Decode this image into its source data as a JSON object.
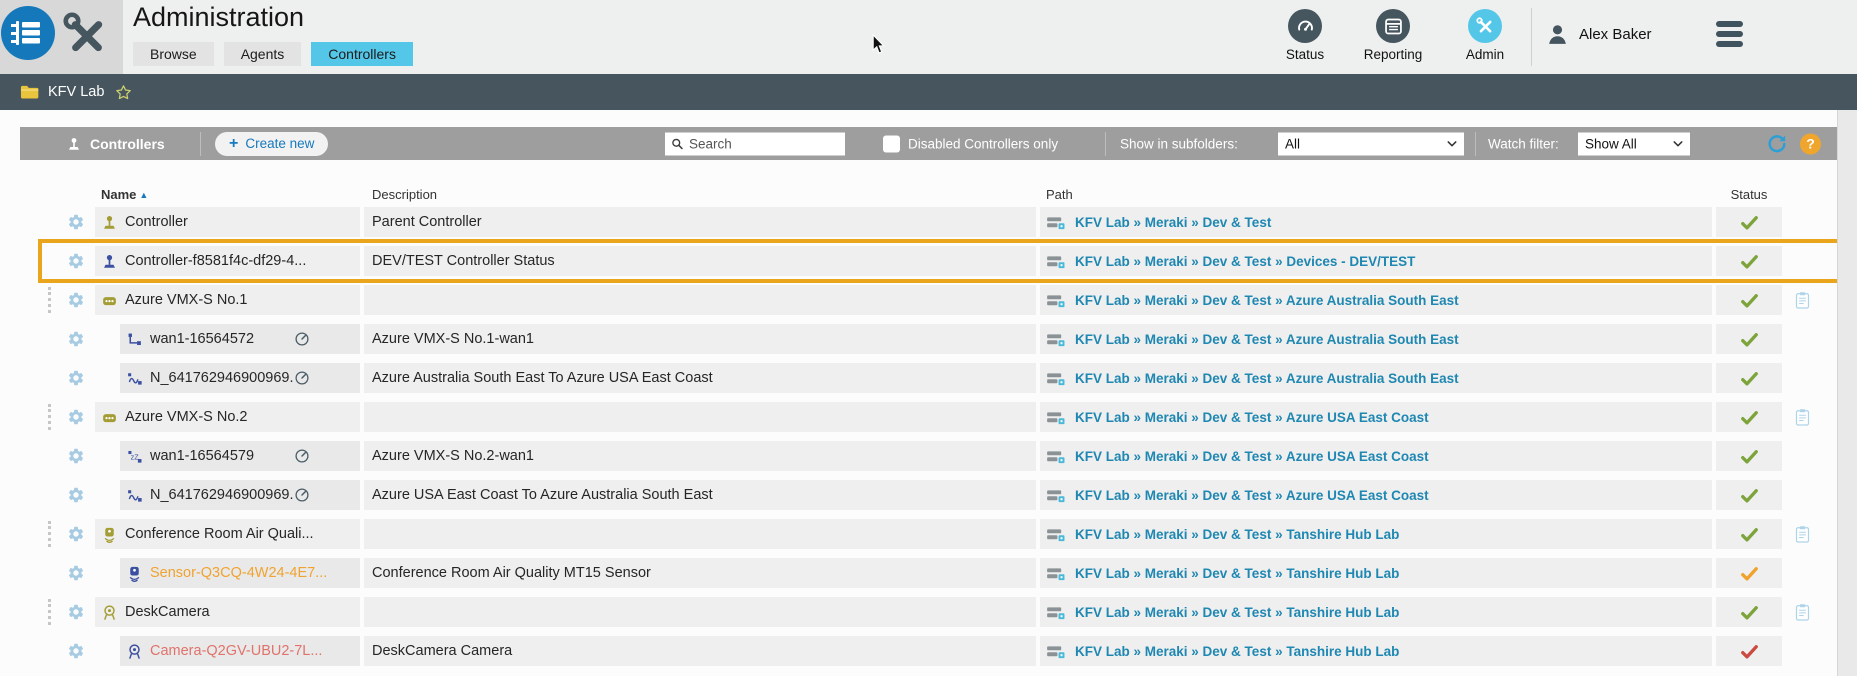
{
  "header": {
    "title": "Administration",
    "tabs": [
      {
        "label": "Browse",
        "active": false
      },
      {
        "label": "Agents",
        "active": false
      },
      {
        "label": "Controllers",
        "active": true
      }
    ],
    "nav": [
      {
        "label": "Status",
        "icon": "gauge-icon"
      },
      {
        "label": "Reporting",
        "icon": "report-icon"
      },
      {
        "label": "Admin",
        "icon": "tools-icon"
      }
    ],
    "user": "Alex Baker"
  },
  "breadcrumb": {
    "location": "KFV Lab"
  },
  "toolbar": {
    "title": "Controllers",
    "create_label": "Create new",
    "search_placeholder": "Search",
    "checkbox_label": "Disabled Controllers only",
    "checkbox_checked": false,
    "subfolders_label": "Show in subfolders:",
    "subfolders_value": "All",
    "watch_label": "Watch filter:",
    "watch_value": "Show All"
  },
  "table": {
    "columns": [
      "Name",
      "Description",
      "Path",
      "Status"
    ],
    "sorted_by": "Name",
    "sort_direction": "asc",
    "rows": [
      {
        "name": "Controller",
        "icon": "joystick",
        "icon_tone": "olive",
        "name_tone": "default",
        "indent": false,
        "gauge": false,
        "drag_handle": false,
        "description": "Parent Controller",
        "path": "KFV Lab » Meraki » Dev & Test",
        "status": "ok",
        "clipboard": false,
        "highlighted": false
      },
      {
        "name": "Controller-f8581f4c-df29-4...",
        "icon": "joystick",
        "icon_tone": "blue",
        "name_tone": "default",
        "indent": false,
        "gauge": false,
        "drag_handle": false,
        "description": "DEV/TEST Controller Status",
        "path": "KFV Lab » Meraki » Dev & Test » Devices - DEV/TEST",
        "status": "ok",
        "clipboard": false,
        "highlighted": true
      },
      {
        "name": "Azure VMX-S No.1",
        "icon": "robot",
        "icon_tone": "olive",
        "name_tone": "default",
        "indent": false,
        "gauge": false,
        "drag_handle": true,
        "description": "",
        "path": "KFV Lab » Meraki » Dev & Test » Azure Australia South East",
        "status": "ok",
        "clipboard": true,
        "highlighted": false
      },
      {
        "name": "wan1-16564572",
        "icon": "interface",
        "icon_tone": "blue",
        "name_tone": "default",
        "indent": true,
        "gauge": true,
        "drag_handle": false,
        "description": "Azure VMX-S No.1-wan1",
        "path": "KFV Lab » Meraki » Dev & Test » Azure Australia South East",
        "status": "ok",
        "clipboard": false,
        "highlighted": false
      },
      {
        "name": "N_641762946900969...",
        "icon": "tunnel",
        "icon_tone": "blue",
        "name_tone": "default",
        "indent": true,
        "gauge": true,
        "drag_handle": false,
        "description": "Azure Australia South East To Azure USA East Coast",
        "path": "KFV Lab » Meraki » Dev & Test » Azure Australia South East",
        "status": "ok",
        "clipboard": false,
        "highlighted": false
      },
      {
        "name": "Azure VMX-S No.2",
        "icon": "robot",
        "icon_tone": "olive",
        "name_tone": "default",
        "indent": false,
        "gauge": false,
        "drag_handle": true,
        "description": "",
        "path": "KFV Lab » Meraki » Dev & Test » Azure USA East Coast",
        "status": "ok",
        "clipboard": true,
        "highlighted": false
      },
      {
        "name": "wan1-16564579",
        "icon": "interface-sleep",
        "icon_tone": "blue",
        "name_tone": "default",
        "indent": true,
        "gauge": true,
        "drag_handle": false,
        "description": "Azure VMX-S No.2-wan1",
        "path": "KFV Lab » Meraki » Dev & Test » Azure USA East Coast",
        "status": "ok",
        "clipboard": false,
        "highlighted": false
      },
      {
        "name": "N_641762946900969...",
        "icon": "tunnel",
        "icon_tone": "blue",
        "name_tone": "default",
        "indent": true,
        "gauge": true,
        "drag_handle": false,
        "description": "Azure USA East Coast To Azure Australia South East",
        "path": "KFV Lab » Meraki » Dev & Test » Azure USA East Coast",
        "status": "ok",
        "clipboard": false,
        "highlighted": false
      },
      {
        "name": "Conference Room Air Quali...",
        "icon": "sensor",
        "icon_tone": "olive",
        "name_tone": "default",
        "indent": false,
        "gauge": false,
        "drag_handle": true,
        "description": "",
        "path": "KFV Lab » Meraki » Dev & Test » Tanshire Hub Lab",
        "status": "ok",
        "clipboard": true,
        "highlighted": false
      },
      {
        "name": "Sensor-Q3CQ-4W24-4E7...",
        "icon": "sensor",
        "icon_tone": "blue",
        "name_tone": "orange",
        "indent": true,
        "gauge": false,
        "drag_handle": false,
        "description": "Conference Room Air Quality MT15 Sensor",
        "path": "KFV Lab » Meraki » Dev & Test » Tanshire Hub Lab",
        "status": "warning",
        "clipboard": false,
        "highlighted": false
      },
      {
        "name": "DeskCamera",
        "icon": "camera",
        "icon_tone": "olive",
        "name_tone": "default",
        "indent": false,
        "gauge": false,
        "drag_handle": true,
        "description": "",
        "path": "KFV Lab » Meraki » Dev & Test » Tanshire Hub Lab",
        "status": "ok",
        "clipboard": true,
        "highlighted": false
      },
      {
        "name": "Camera-Q2GV-UBU2-7L...",
        "icon": "camera",
        "icon_tone": "blue",
        "name_tone": "red",
        "indent": true,
        "gauge": false,
        "drag_handle": false,
        "description": "DeskCamera Camera",
        "path": "KFV Lab » Meraki » Dev & Test » Tanshire Hub Lab",
        "status": "error",
        "clipboard": false,
        "highlighted": false
      }
    ]
  },
  "colors": {
    "accent_blue": "#1779be",
    "active_cyan": "#54c7e9",
    "slate": "#46565f",
    "toolbar_gray": "#9e9e9e",
    "breadcrumb_bar": "#47565e",
    "path_link": "#1e87b2",
    "highlight_orange": "#e9a51c",
    "status_ok": "#7da33b",
    "status_warning": "#f0a22c",
    "status_error": "#cb4a42",
    "gear_blue": "#a6cbe2",
    "icon_olive": "#a49d35",
    "icon_indigo": "#3c50a2",
    "help_orange": "#f0a62d"
  }
}
